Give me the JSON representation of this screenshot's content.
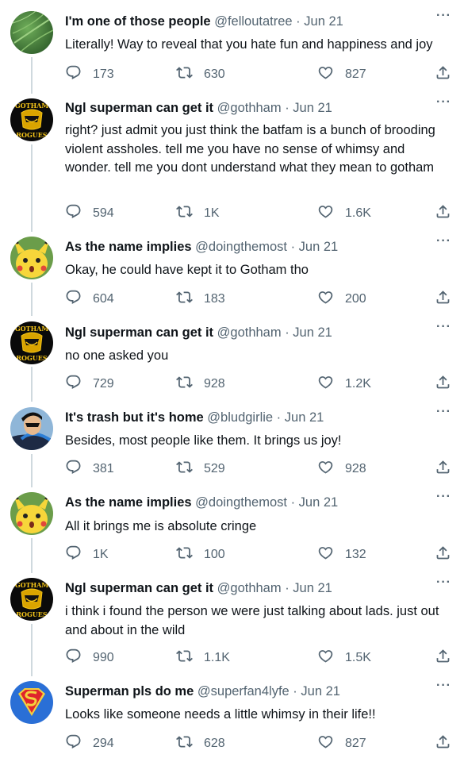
{
  "tweets": [
    {
      "name": "I'm one of those people",
      "handle": "@felloutatree",
      "date": "Jun 21",
      "text": "Literally! Way to reveal that you hate fun and happiness and joy",
      "replies": "173",
      "retweets": "630",
      "likes": "827",
      "avatar": "green-leaf"
    },
    {
      "name": "Ngl superman can get it",
      "handle": "@gothham",
      "date": "Jun 21",
      "text": "right? just admit you just think the batfam is a bunch of brooding violent assholes. tell me you have no sense of whimsy and wonder. tell me you dont understand what they mean to gotham",
      "replies": "594",
      "retweets": "1K",
      "likes": "1.6K",
      "avatar": "gotham-rogues",
      "avatar_top_text": "GOTHAM",
      "avatar_bottom_text": "ROGUES"
    },
    {
      "name": "As the name implies",
      "handle": "@doingthemost",
      "date": "Jun 21",
      "text": "Okay, he could have kept it to Gotham tho",
      "replies": "604",
      "retweets": "183",
      "likes": "200",
      "avatar": "surprised-pikachu"
    },
    {
      "name": "Ngl superman can get it",
      "handle": "@gothham",
      "date": "Jun 21",
      "text": "no one asked you",
      "replies": "729",
      "retweets": "928",
      "likes": "1.2K",
      "avatar": "gotham-rogues",
      "avatar_top_text": "GOTHAM",
      "avatar_bottom_text": "ROGUES"
    },
    {
      "name": "It's trash but it's home",
      "handle": "@bludgirlie",
      "date": "Jun 21",
      "text": "Besides, most people like them. It brings us joy!",
      "replies": "381",
      "retweets": "529",
      "likes": "928",
      "avatar": "nightwing"
    },
    {
      "name": "As the name implies",
      "handle": "@doingthemost",
      "date": "Jun 21",
      "text": "All it brings me is absolute cringe",
      "replies": "1K",
      "retweets": "100",
      "likes": "132",
      "avatar": "surprised-pikachu"
    },
    {
      "name": "Ngl superman can get it",
      "handle": "@gothham",
      "date": "Jun 21",
      "text": "i think i found the person we were just talking about lads. just out and about in the wild",
      "replies": "990",
      "retweets": "1.1K",
      "likes": "1.5K",
      "avatar": "gotham-rogues",
      "avatar_top_text": "GOTHAM",
      "avatar_bottom_text": "ROGUES"
    },
    {
      "name": "Superman pls do me",
      "handle": "@superfan4lyfe",
      "date": "Jun 21",
      "text": "Looks like someone needs a little whimsy in their life!!",
      "replies": "294",
      "retweets": "628",
      "likes": "827",
      "avatar": "superman-shield"
    }
  ],
  "separator": " · ",
  "colors": {
    "text": "#0f1419",
    "secondary": "#536471",
    "thread_line": "#cfd9de"
  },
  "icons": [
    "reply-icon",
    "retweet-icon",
    "like-icon",
    "share-icon",
    "more-options-icon"
  ]
}
